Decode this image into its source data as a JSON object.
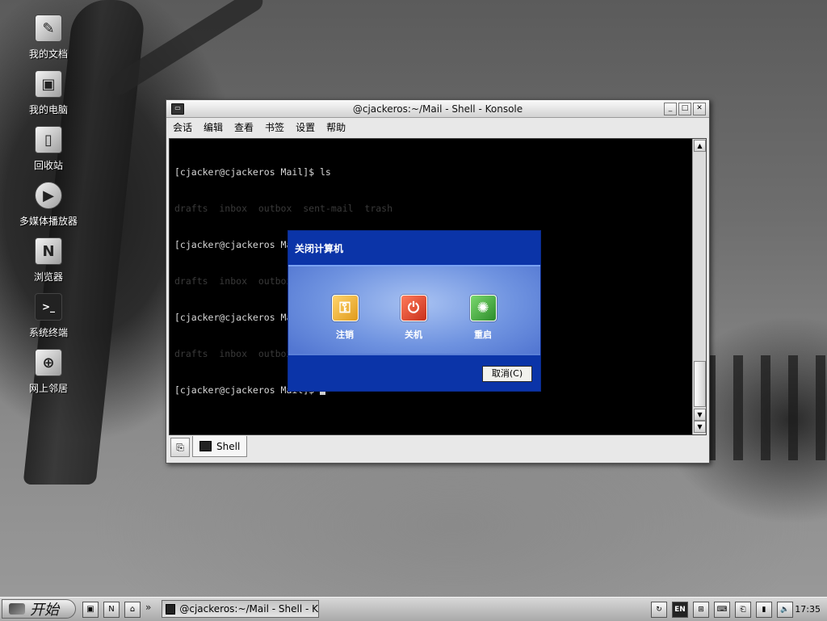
{
  "desktop": {
    "icons": [
      {
        "label": "我的文档",
        "icon": "documents-icon"
      },
      {
        "label": "我的电脑",
        "icon": "computer-icon"
      },
      {
        "label": "回收站",
        "icon": "trash-icon"
      },
      {
        "label": "多媒体播放器",
        "icon": "media-player-icon"
      },
      {
        "label": "浏览器",
        "icon": "browser-icon"
      },
      {
        "label": "系统终端",
        "icon": "terminal-icon"
      },
      {
        "label": "网上邻居",
        "icon": "network-icon"
      }
    ]
  },
  "konsole": {
    "title": "@cjackeros:~/Mail - Shell - Konsole",
    "menu": [
      "会话",
      "编辑",
      "查看",
      "书签",
      "设置",
      "帮助"
    ],
    "lines": [
      {
        "text": "[cjacker@cjackeros Mail]$ ls",
        "dim": false
      },
      {
        "text": "drafts  inbox  outbox  sent-mail  trash",
        "dim": true
      },
      {
        "text": "[cjacker@cjackeros Mail]$ ls",
        "dim": false
      },
      {
        "text": "drafts  inbox  outbox  sent-mail  trash",
        "dim": true
      },
      {
        "text": "[cjacker@cjackeros Mail]$ ls",
        "dim": false
      },
      {
        "text": "drafts  inbox  outbox  sent-mail  trash",
        "dim": true
      },
      {
        "text": "[cjacker@cjackeros Mail]$ ",
        "dim": false,
        "cursor": true
      }
    ],
    "tab_label": "Shell"
  },
  "shutdown_dialog": {
    "title": "关闭计算机",
    "logoff_label": "注销",
    "shutdown_label": "关机",
    "restart_label": "重启",
    "cancel_label": "取消(C)"
  },
  "taskbar": {
    "start_label": "开始",
    "task_title": "@cjackeros:~/Mail - Shell - K",
    "tray_input": "EN",
    "clock": "17:35"
  }
}
